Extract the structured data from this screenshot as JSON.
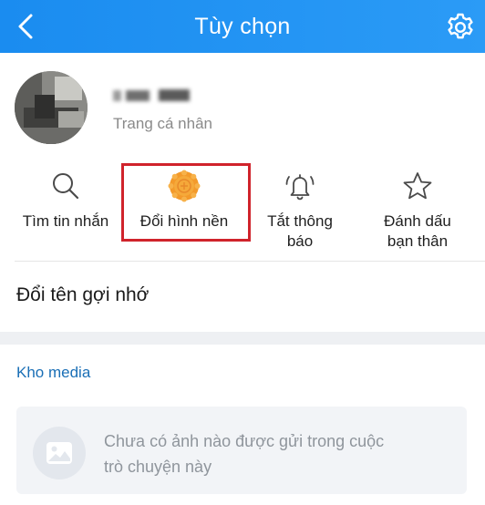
{
  "header": {
    "title": "Tùy chọn",
    "back_icon": "chevron-left-icon",
    "settings_icon": "gear-icon",
    "bg_color": "#1a8cf0"
  },
  "profile": {
    "subtitle": "Trang cá nhân"
  },
  "actions": [
    {
      "icon": "search-icon",
      "label": "Tìm tin nhắn"
    },
    {
      "icon": "mooncake-icon",
      "label": "Đổi hình nền",
      "highlighted": true,
      "highlight_color": "#d0232b"
    },
    {
      "icon": "bell-off-icon",
      "label_line1": "Tắt thông",
      "label_line2": "báo"
    },
    {
      "icon": "star-icon",
      "label_line1": "Đánh dấu",
      "label_line2": "bạn thân"
    }
  ],
  "rename": {
    "label": "Đổi tên gợi nhớ"
  },
  "media": {
    "title": "Kho media",
    "title_color": "#1a6fb6",
    "empty_line1": "Chưa có ảnh nào được gửi trong cuộc",
    "empty_line2": "trò chuyện này",
    "empty_icon": "image-icon"
  }
}
